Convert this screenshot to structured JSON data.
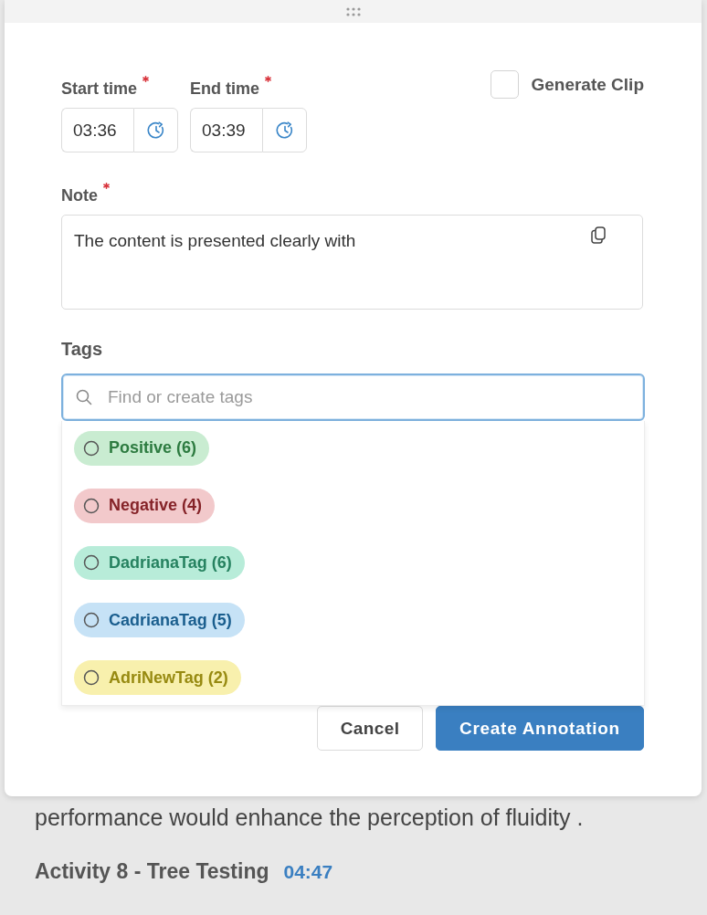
{
  "form": {
    "start_time": {
      "label": "Start time",
      "required": true,
      "value": "03:36"
    },
    "end_time": {
      "label": "End time",
      "required": true,
      "value": "03:39"
    },
    "generate_clip": {
      "label": "Generate Clip",
      "checked": false
    },
    "note": {
      "label": "Note",
      "required": true,
      "value": "The content is presented clearly with"
    },
    "tags": {
      "label": "Tags",
      "search": {
        "placeholder": "Find or create tags",
        "focused": true
      },
      "options": [
        {
          "label": "Positive (6)",
          "color": "#c9ecd1",
          "selected": false
        },
        {
          "label": "Negative (4)",
          "color": "#f2c9cb",
          "selected": false
        },
        {
          "label": "DadrianaTag (6)",
          "color": "#b8ecd9",
          "selected": false
        },
        {
          "label": "CadrianaTag (5)",
          "color": "#c6e2f6",
          "selected": false
        },
        {
          "label": "AdriNewTag (2)",
          "color": "#f8f0ad",
          "selected": false
        }
      ]
    }
  },
  "buttons": [
    {
      "label": "Cancel",
      "kind": "secondary"
    },
    {
      "label": "Create Annotation",
      "kind": "primary"
    }
  ],
  "background_content": {
    "text": "performance would enhance the perception of fluidity .",
    "activity": "Activity 8 - Tree Testing",
    "time": "04:47"
  }
}
